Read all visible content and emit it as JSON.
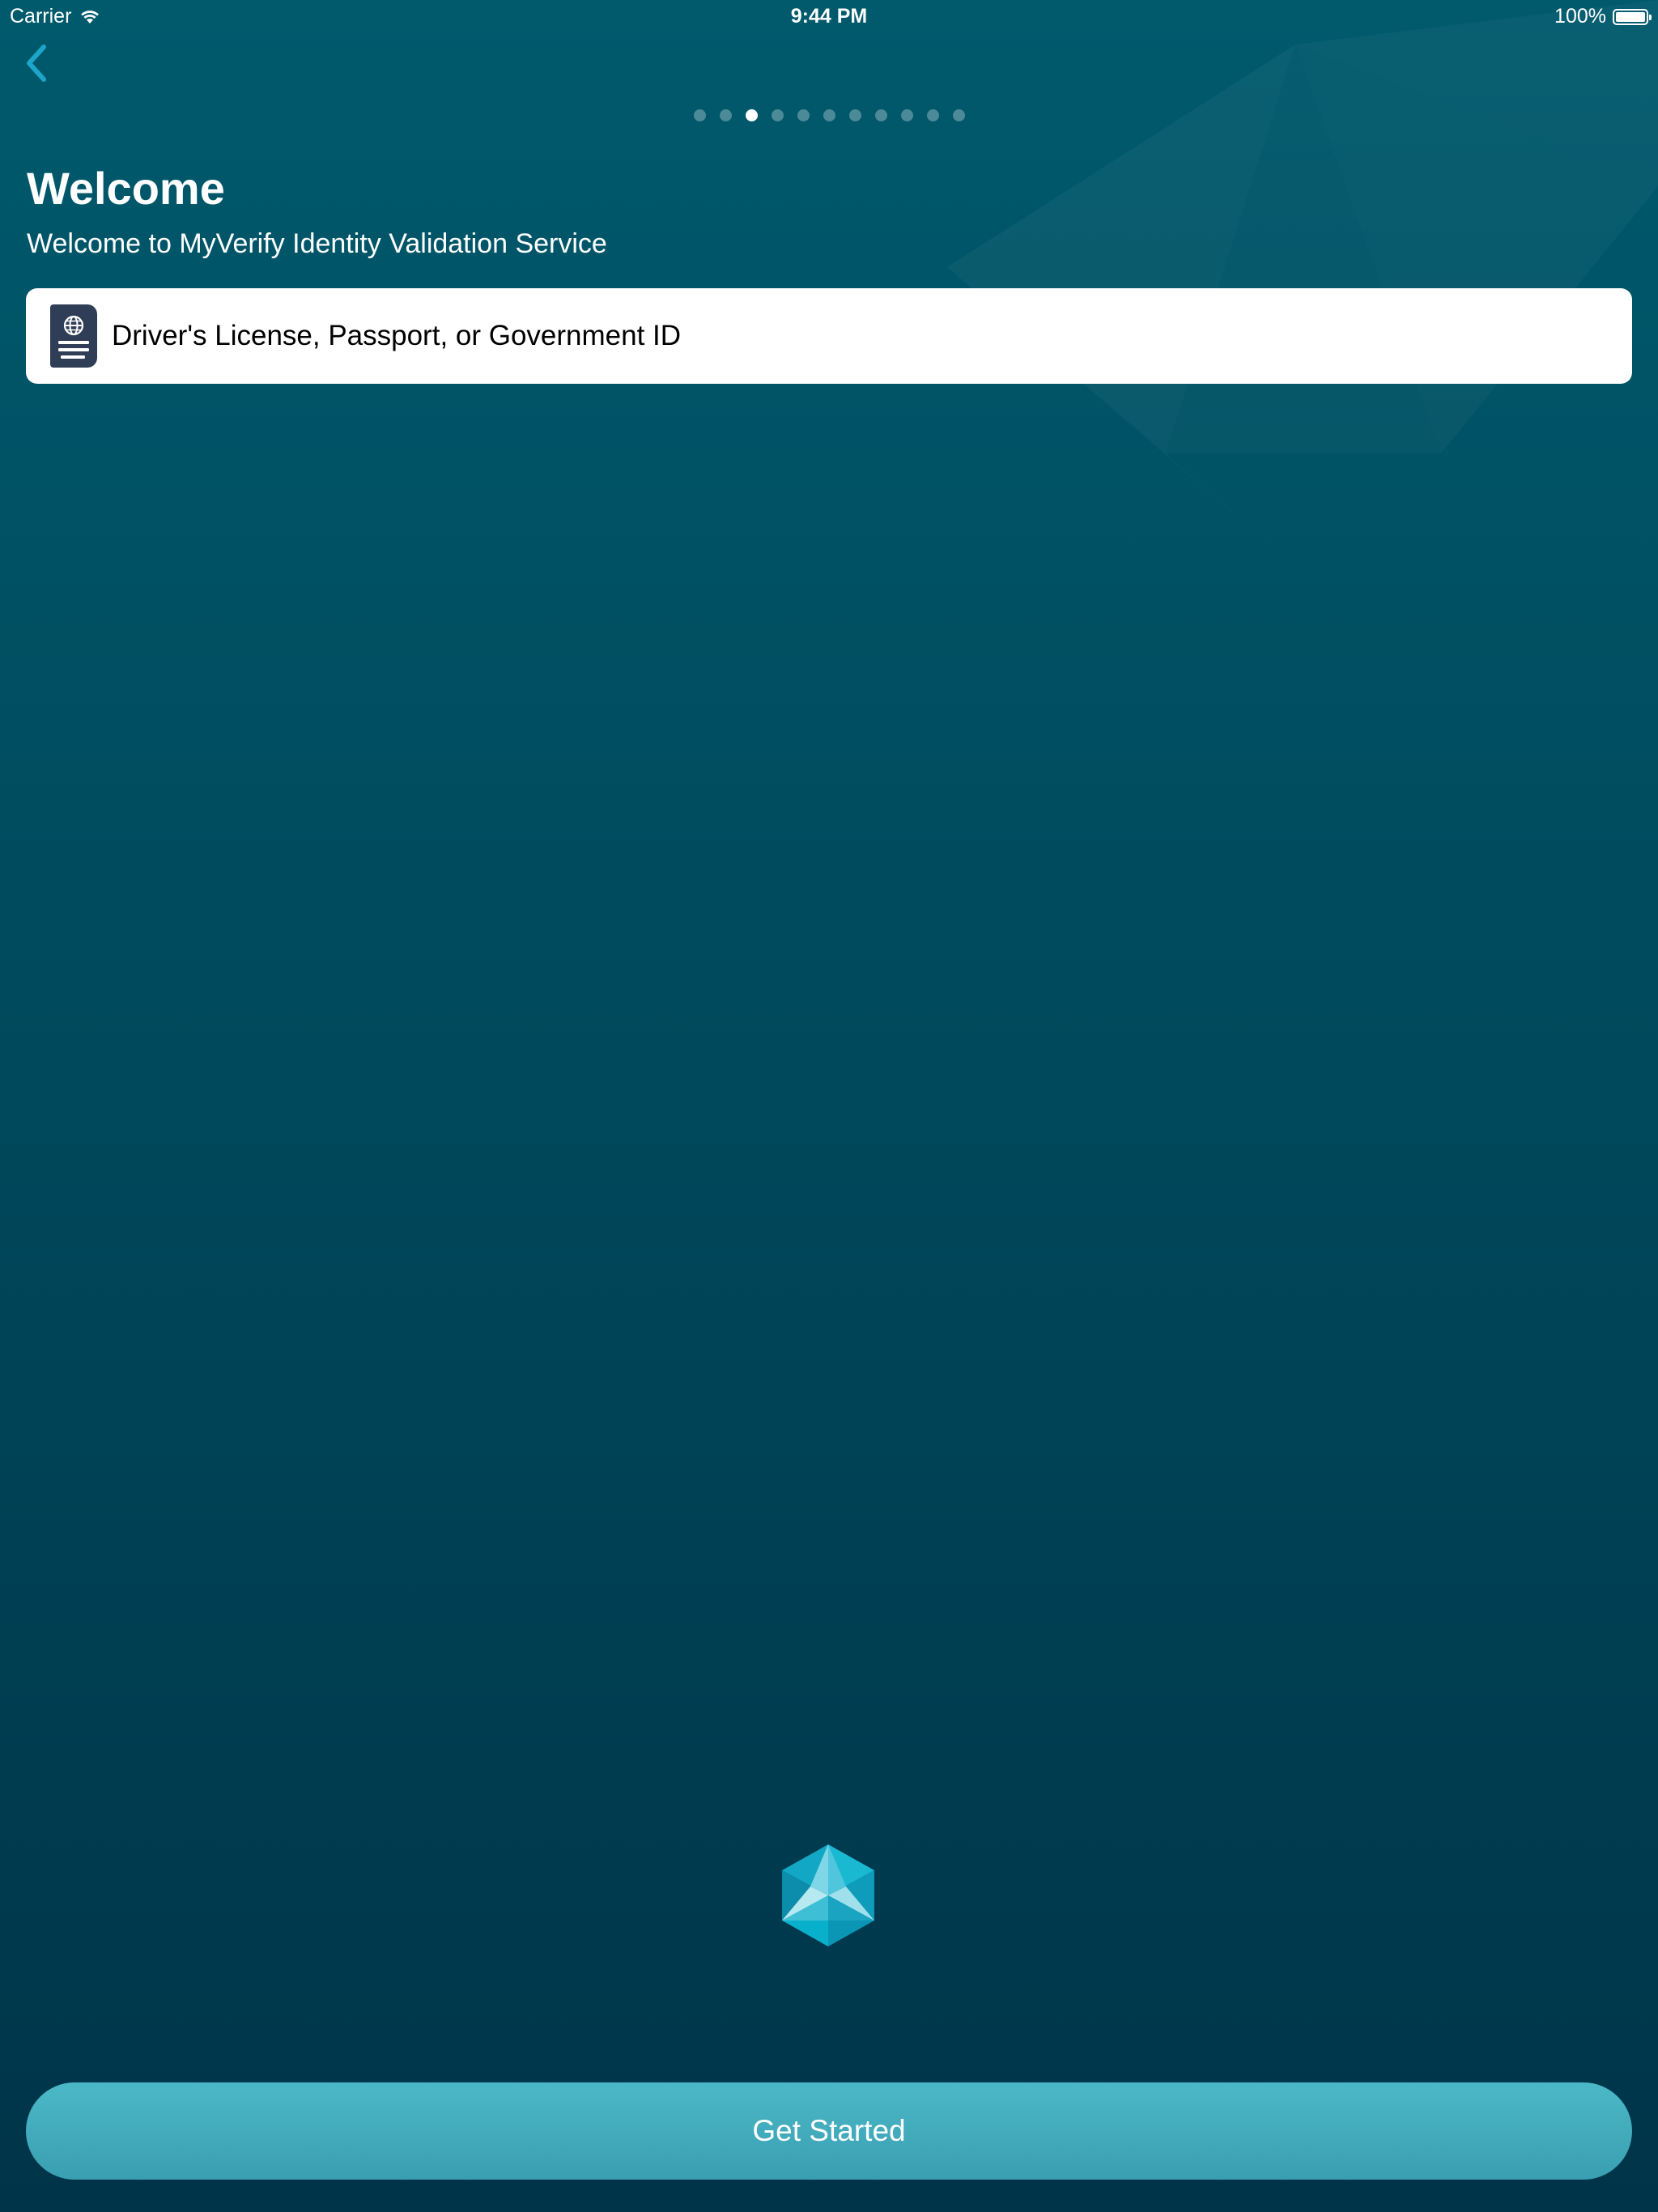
{
  "status_bar": {
    "carrier": "Carrier",
    "time": "9:44 PM",
    "battery": "100%",
    "wifi_icon": "wifi-icon",
    "battery_icon": "battery-icon",
    "battery_level": 1.0
  },
  "navigation": {
    "back_icon": "chevron-left-icon",
    "page_count": 11,
    "current_page": 3
  },
  "header": {
    "title": "Welcome",
    "subtitle": "Welcome to MyVerify Identity Validation Service"
  },
  "document_option": {
    "label": "Driver's License, Passport, or Government ID",
    "icon": "passport-icon"
  },
  "logo": {
    "icon": "myverify-logo-icon"
  },
  "actions": {
    "primary_label": "Get Started"
  },
  "colors": {
    "background_top": "#005a6c",
    "background_bottom": "#003449",
    "accent": "#4bb8c8",
    "back_chevron": "#1aa5c9",
    "icon_dark": "#2f3d56"
  }
}
